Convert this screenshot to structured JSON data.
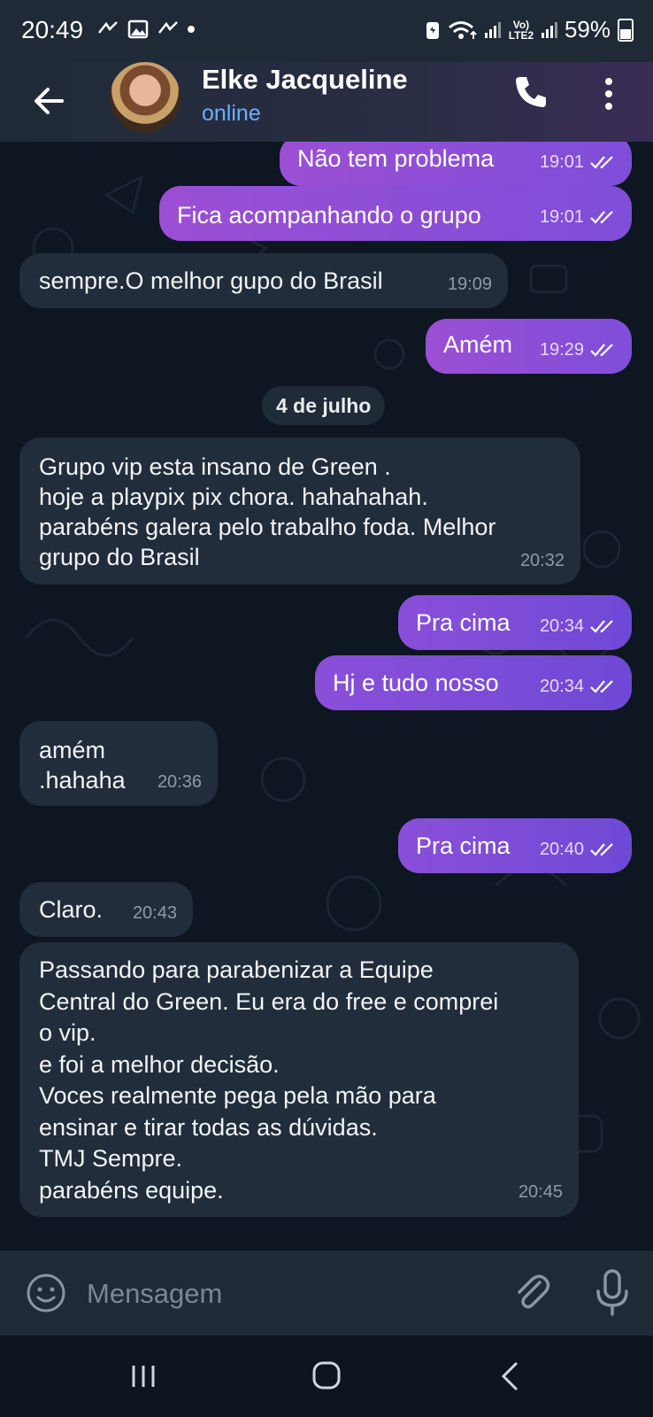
{
  "status_bar": {
    "time": "20:49",
    "battery": "59%",
    "network": "Vo) LTE2"
  },
  "header": {
    "name": "Elke Jacqueline",
    "status": "online"
  },
  "date_separator": "4 de julho",
  "messages": [
    {
      "text": "Não tem problema",
      "time": "19:01",
      "direction": "out"
    },
    {
      "text": "Fica acompanhando o grupo",
      "time": "19:01",
      "direction": "out"
    },
    {
      "text": "sempre.O melhor gupo do Brasil",
      "time": "19:09",
      "direction": "in"
    },
    {
      "text": "Amém",
      "time": "19:29",
      "direction": "out"
    },
    {
      "text": "Grupo vip esta insano de Green .\nhoje a playpix pix chora. hahahahah.\nparabéns galera pelo trabalho foda. Melhor\ngrupo do Brasil",
      "time": "20:32",
      "direction": "in"
    },
    {
      "text": "Pra cima",
      "time": "20:34",
      "direction": "out"
    },
    {
      "text": "Hj e tudo nosso",
      "time": "20:34",
      "direction": "out"
    },
    {
      "text": "amém\n.hahaha",
      "time": "20:36",
      "direction": "in"
    },
    {
      "text": "Pra cima",
      "time": "20:40",
      "direction": "out"
    },
    {
      "text": "Claro.",
      "time": "20:43",
      "direction": "in"
    },
    {
      "text": "Passando para parabenizar a Equipe\nCentral do Green.  Eu era do free e comprei\no vip.\ne foi a melhor decisão.\nVoces realmente pega pela mão para\nensinar e tirar todas as dúvidas.\nTMJ Sempre.\nparabéns equipe.",
      "time": "20:45",
      "direction": "in"
    }
  ],
  "composer": {
    "placeholder": "Mensagem"
  },
  "icons": {
    "back": "arrow-left-icon",
    "call": "phone-icon",
    "menu": "more-vertical-icon",
    "emoji": "smiley-icon",
    "attach": "paperclip-icon",
    "mic": "microphone-icon",
    "read": "double-check-icon"
  },
  "colors": {
    "accent": "#8a4fd8",
    "incoming": "#212d3b",
    "online": "#6ab0ff",
    "background": "#0e1621"
  }
}
